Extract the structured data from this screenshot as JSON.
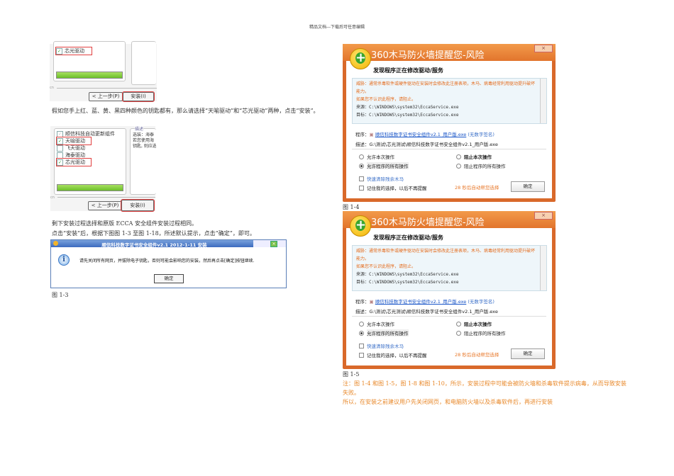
{
  "header": "精品文档---下载后可任意编辑",
  "shot1": {
    "item_xinguang": "芯光驱动",
    "prev": "< 上一步(P)",
    "install": "安装(I)",
    "group": "cn"
  },
  "para1": "假如您手上红、蓝、黄、黑四种颜色的钥匙都有，那么请选择“天喻驱动”和“芯光驱动”两种，点击“安装”。",
  "shot2": {
    "items": [
      "顺信科技自动更新组件",
      "天喻驱动",
      "飞天驱动",
      "海泰驱动",
      "芯光驱动"
    ],
    "desc_label": "描述",
    "desc": "选装：海泰\n若您使用海\n钥匙, 则应选",
    "prev": "< 上一步(P)",
    "install": "安装(I)",
    "group": "cn"
  },
  "para2": "剩下安装过程选择和原版 ECCA 安全组件安装过程相同。",
  "para3": "点击“安装”后，根据下图图 1-3 至图 1-18，所述默认提示，点击“确定”，即可。",
  "msgbox": {
    "title": "顺信科技数字证书安全组件v2.1 2012-1-11 安装",
    "message": "请先关闭所有网页，并拔除电子钥匙，否则可能会影响您的安装，然后再点击[确定]按钮继续.",
    "ok": "确定"
  },
  "cap13": "图 1-3",
  "dialogs": [
    {
      "title": "360木马防火墙提醒您-风险",
      "close": "×",
      "subtitle": "发现程序正在修改驱动/服务",
      "threat": "威胁：通常杀毒软件或硬件驱动在安装时会修改此注册表项，木马、病毒经常利用驱动提升破坏能力。",
      "advice": "如果您不认识此程序，请阻止。",
      "source": "来源：C:\\WINDOWS\\system32\\EccaService.exe",
      "target": "目标：C:\\WINDOWS\\system32\\EccaService.exe",
      "program_label": "程序：",
      "program": "顺信科技数字证书安全组件v2.1_用户版.exe",
      "unsigned": "(无数字签名)",
      "desc": "描述：G:\\测试\\芯光测试\\顺信科技数字证书安全组件v2.1_用户版.exe",
      "opt1": "允许本次操作",
      "opt2": "允许程序的所有操作",
      "opt3": "阻止本次操作",
      "opt4": "阻止程序的所有操作",
      "clean": "快速清除残余木马",
      "remember": "记住我的选择，以后不再提醒",
      "countdown": "28 秒后自动帮您选择",
      "ok": "确定"
    },
    {
      "title": "360木马防火墙提醒您-风险",
      "close": "×",
      "subtitle": "发现程序正在修改驱动/服务",
      "threat": "威胁：通常杀毒软件或硬件驱动在安装时会修改此注册表项，木马、病毒经常利用驱动提升破坏能力。",
      "advice": "如果您不认识此程序，请阻止。",
      "source": "来源：C:\\WINDOWS\\system32\\EccaService.exe",
      "target": "目标：C:\\WINDOWS\\system32\\EccaService.exe",
      "program_label": "程序：",
      "program": "顺信科技数字证书安全组件v2.1_用户版.exe",
      "unsigned": "(无数字签名)",
      "desc": "描述：G:\\测试\\芯光测试\\顺信科技数字证书安全组件v2.1_用户版.exe",
      "opt1": "允许本次操作",
      "opt2": "允许程序的所有操作",
      "opt3": "阻止本次操作",
      "opt4": "阻止程序的所有操作",
      "clean": "快速清除残余木马",
      "remember": "记住我的选择，以后不再提醒",
      "countdown": "28 秒后自动帮您选择",
      "ok": "确定"
    }
  ],
  "cap14": "图 1-4",
  "cap15": "图 1-5",
  "note1": "注：图 1-4 和图 1-5，图 1-8 和图 1-10，所示，安装过程中可能会被防火墙和杀毒软件提示病毒，从而导致安装失败。",
  "note2": "所以，在安装之前建议用户先关闭网页，和电脑防火墙以及杀毒软件后，再进行安装"
}
